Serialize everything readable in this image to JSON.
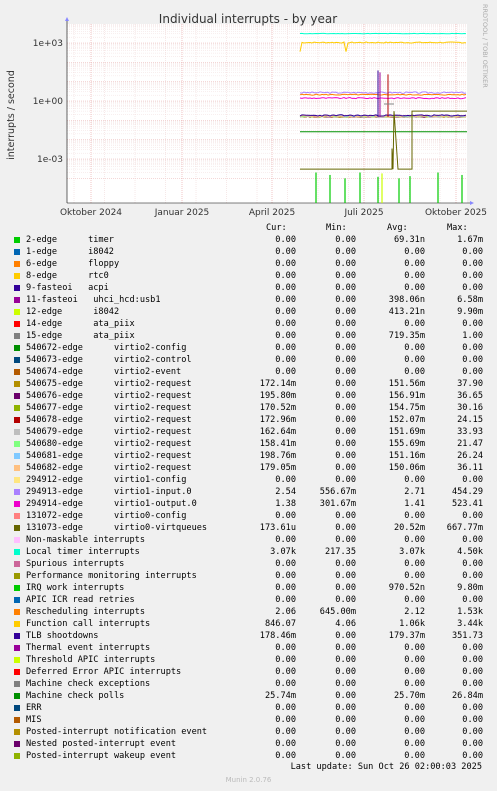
{
  "chart_data": {
    "type": "line",
    "title": "Individual interrupts - by year",
    "ylabel": "interrupts / second",
    "watermark": "RRDTOOL / TOBI OETIKER",
    "y_scale": "log",
    "y_ticks": [
      {
        "label": "1e+03",
        "value": 1000
      },
      {
        "label": "1e+00",
        "value": 1
      },
      {
        "label": "1e-03",
        "value": 0.001
      }
    ],
    "x_ticks": [
      "Oktober 2024",
      "Januar 2025",
      "April 2025",
      "Juli 2025",
      "Oktober 2025"
    ],
    "grid": true,
    "columns": [
      "Cur:",
      "Min:",
      "Avg:",
      "Max:"
    ],
    "series": [
      {
        "label": "2-edge      timer",
        "color": "#00cc00",
        "cur": "0.00",
        "min": "0.00",
        "avg": "69.31n",
        "max": "1.67m"
      },
      {
        "label": "1-edge      i8042",
        "color": "#0066b3",
        "cur": "0.00",
        "min": "0.00",
        "avg": "0.00",
        "max": "0.00"
      },
      {
        "label": "6-edge      floppy",
        "color": "#ff8000",
        "cur": "0.00",
        "min": "0.00",
        "avg": "0.00",
        "max": "0.00"
      },
      {
        "label": "8-edge      rtc0",
        "color": "#ffcc00",
        "cur": "0.00",
        "min": "0.00",
        "avg": "0.00",
        "max": "0.00"
      },
      {
        "label": "9-fasteoi   acpi",
        "color": "#330099",
        "cur": "0.00",
        "min": "0.00",
        "avg": "0.00",
        "max": "0.00"
      },
      {
        "label": "11-fasteoi   uhci_hcd:usb1",
        "color": "#990099",
        "cur": "0.00",
        "min": "0.00",
        "avg": "398.06n",
        "max": "6.58m"
      },
      {
        "label": "12-edge      i8042",
        "color": "#ccff00",
        "cur": "0.00",
        "min": "0.00",
        "avg": "413.21n",
        "max": "9.90m"
      },
      {
        "label": "14-edge      ata_piix",
        "color": "#ff0000",
        "cur": "0.00",
        "min": "0.00",
        "avg": "0.00",
        "max": "0.00"
      },
      {
        "label": "15-edge      ata_piix",
        "color": "#808080",
        "cur": "0.00",
        "min": "0.00",
        "avg": "719.35m",
        "max": "1.00"
      },
      {
        "label": "540672-edge      virtio2-config",
        "color": "#008f00",
        "cur": "0.00",
        "min": "0.00",
        "avg": "0.00",
        "max": "0.00"
      },
      {
        "label": "540673-edge      virtio2-control",
        "color": "#00487d",
        "cur": "0.00",
        "min": "0.00",
        "avg": "0.00",
        "max": "0.00"
      },
      {
        "label": "540674-edge      virtio2-event",
        "color": "#b35a00",
        "cur": "0.00",
        "min": "0.00",
        "avg": "0.00",
        "max": "0.00"
      },
      {
        "label": "540675-edge      virtio2-request",
        "color": "#b38f00",
        "cur": "172.14m",
        "min": "0.00",
        "avg": "151.56m",
        "max": "37.90"
      },
      {
        "label": "540676-edge      virtio2-request",
        "color": "#6b006b",
        "cur": "195.80m",
        "min": "0.00",
        "avg": "156.91m",
        "max": "36.65"
      },
      {
        "label": "540677-edge      virtio2-request",
        "color": "#8fb300",
        "cur": "170.52m",
        "min": "0.00",
        "avg": "154.75m",
        "max": "30.16"
      },
      {
        "label": "540678-edge      virtio2-request",
        "color": "#b30000",
        "cur": "172.96m",
        "min": "0.00",
        "avg": "152.07m",
        "max": "24.15"
      },
      {
        "label": "540679-edge      virtio2-request",
        "color": "#bebebe",
        "cur": "162.64m",
        "min": "0.00",
        "avg": "151.69m",
        "max": "33.93"
      },
      {
        "label": "540680-edge      virtio2-request",
        "color": "#80ff80",
        "cur": "158.41m",
        "min": "0.00",
        "avg": "155.69m",
        "max": "21.47"
      },
      {
        "label": "540681-edge      virtio2-request",
        "color": "#80c9ff",
        "cur": "198.76m",
        "min": "0.00",
        "avg": "151.16m",
        "max": "26.24"
      },
      {
        "label": "540682-edge      virtio2-request",
        "color": "#ffc080",
        "cur": "179.05m",
        "min": "0.00",
        "avg": "150.06m",
        "max": "36.11"
      },
      {
        "label": "294912-edge      virtio1-config",
        "color": "#ffe680",
        "cur": "0.00",
        "min": "0.00",
        "avg": "0.00",
        "max": "0.00"
      },
      {
        "label": "294913-edge      virtio1-input.0",
        "color": "#aa80ff",
        "cur": "2.54",
        "min": "556.67m",
        "avg": "2.71",
        "max": "454.29"
      },
      {
        "label": "294914-edge      virtio1-output.0",
        "color": "#ee00cc",
        "cur": "1.38",
        "min": "301.67m",
        "avg": "1.41",
        "max": "523.41"
      },
      {
        "label": "131072-edge      virtio0-config",
        "color": "#ff8080",
        "cur": "0.00",
        "min": "0.00",
        "avg": "0.00",
        "max": "0.00"
      },
      {
        "label": "131073-edge      virtio0-virtqueues",
        "color": "#666600",
        "cur": "173.61u",
        "min": "0.00",
        "avg": "20.52m",
        "max": "667.77m"
      },
      {
        "label": "Non-maskable interrupts",
        "color": "#ffbfff",
        "cur": "0.00",
        "min": "0.00",
        "avg": "0.00",
        "max": "0.00"
      },
      {
        "label": "Local timer interrupts",
        "color": "#00ffcc",
        "cur": "3.07k",
        "min": "217.35",
        "avg": "3.07k",
        "max": "4.50k"
      },
      {
        "label": "Spurious interrupts",
        "color": "#cc6699",
        "cur": "0.00",
        "min": "0.00",
        "avg": "0.00",
        "max": "0.00"
      },
      {
        "label": "Performance monitoring interrupts",
        "color": "#999900",
        "cur": "0.00",
        "min": "0.00",
        "avg": "0.00",
        "max": "0.00"
      },
      {
        "label": "IRQ work interrupts",
        "color": "#00cc00",
        "cur": "0.00",
        "min": "0.00",
        "avg": "970.52n",
        "max": "9.80m"
      },
      {
        "label": "APIC ICR read retries",
        "color": "#0066b3",
        "cur": "0.00",
        "min": "0.00",
        "avg": "0.00",
        "max": "0.00"
      },
      {
        "label": "Rescheduling interrupts",
        "color": "#ff8000",
        "cur": "2.06",
        "min": "645.00m",
        "avg": "2.12",
        "max": "1.53k"
      },
      {
        "label": "Function call interrupts",
        "color": "#ffcc00",
        "cur": "846.07",
        "min": "4.06",
        "avg": "1.06k",
        "max": "3.44k"
      },
      {
        "label": "TLB shootdowns",
        "color": "#330099",
        "cur": "178.46m",
        "min": "0.00",
        "avg": "179.37m",
        "max": "351.73"
      },
      {
        "label": "Thermal event interrupts",
        "color": "#990099",
        "cur": "0.00",
        "min": "0.00",
        "avg": "0.00",
        "max": "0.00"
      },
      {
        "label": "Threshold APIC interrupts",
        "color": "#ccff00",
        "cur": "0.00",
        "min": "0.00",
        "avg": "0.00",
        "max": "0.00"
      },
      {
        "label": "Deferred Error APIC interrupts",
        "color": "#ff0000",
        "cur": "0.00",
        "min": "0.00",
        "avg": "0.00",
        "max": "0.00"
      },
      {
        "label": "Machine check exceptions",
        "color": "#808080",
        "cur": "0.00",
        "min": "0.00",
        "avg": "0.00",
        "max": "0.00"
      },
      {
        "label": "Machine check polls",
        "color": "#008f00",
        "cur": "25.74m",
        "min": "0.00",
        "avg": "25.70m",
        "max": "26.84m"
      },
      {
        "label": "ERR",
        "color": "#00487d",
        "cur": "0.00",
        "min": "0.00",
        "avg": "0.00",
        "max": "0.00"
      },
      {
        "label": "MIS",
        "color": "#b35a00",
        "cur": "0.00",
        "min": "0.00",
        "avg": "0.00",
        "max": "0.00"
      },
      {
        "label": "Posted-interrupt notification event",
        "color": "#b38f00",
        "cur": "0.00",
        "min": "0.00",
        "avg": "0.00",
        "max": "0.00"
      },
      {
        "label": "Nested posted-interrupt event",
        "color": "#6b006b",
        "cur": "0.00",
        "min": "0.00",
        "avg": "0.00",
        "max": "0.00"
      },
      {
        "label": "Posted-interrupt wakeup event",
        "color": "#8fb300",
        "cur": "0.00",
        "min": "0.00",
        "avg": "0.00",
        "max": "0.00"
      }
    ]
  },
  "last_update": "Last update: Sun Oct 26 02:00:03 2025",
  "footer": "Munin 2.0.76"
}
